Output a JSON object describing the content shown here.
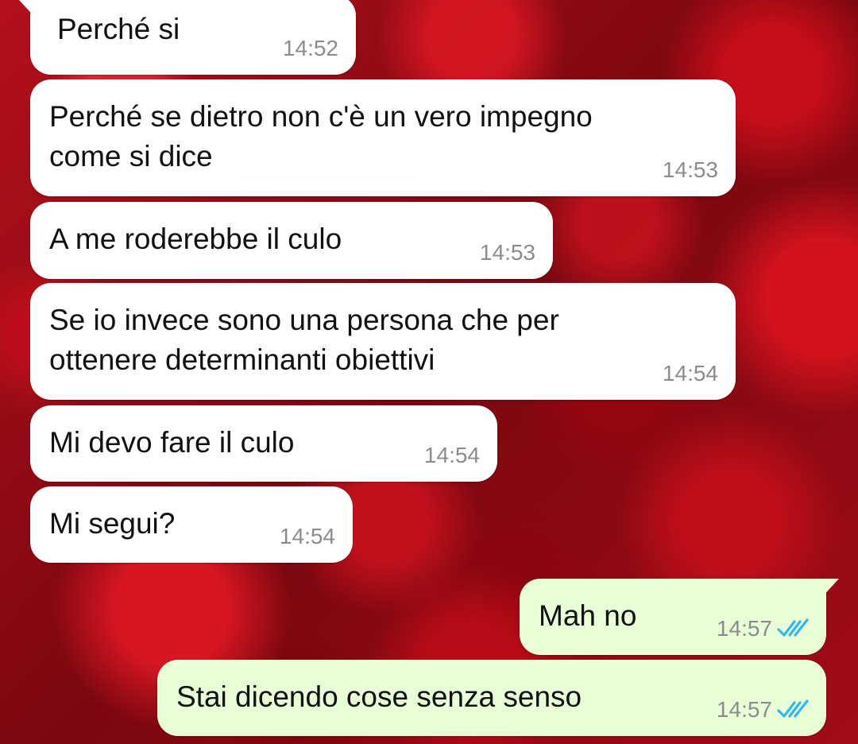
{
  "messages": [
    {
      "direction": "incoming",
      "text": "Perché si",
      "time": "14:52"
    },
    {
      "direction": "incoming",
      "text": "Perché se dietro non c'è un vero impegno\ncome si dice",
      "time": "14:53"
    },
    {
      "direction": "incoming",
      "text": "A me roderebbe il culo",
      "time": "14:53"
    },
    {
      "direction": "incoming",
      "text": "Se io invece sono una persona che per\nottenere determinanti obiettivi",
      "time": "14:54"
    },
    {
      "direction": "incoming",
      "text": "Mi devo fare il culo",
      "time": "14:54"
    },
    {
      "direction": "incoming",
      "text": "Mi segui?",
      "time": "14:54"
    },
    {
      "direction": "outgoing",
      "text": "Mah no",
      "time": "14:57",
      "status_icon": "double-check-read-icon"
    },
    {
      "direction": "outgoing",
      "text": "Stai dicendo cose senza senso",
      "time": "14:57",
      "status_icon": "double-check-read-icon"
    }
  ],
  "colors": {
    "incoming_bubble": "#ffffff",
    "outgoing_bubble": "#e7fed7",
    "timestamp": "#8c8c8c",
    "read_ticks": "#34b7f1",
    "wallpaper": "#8e0a12"
  },
  "wallpaper_icon": "red-roses-wallpaper"
}
